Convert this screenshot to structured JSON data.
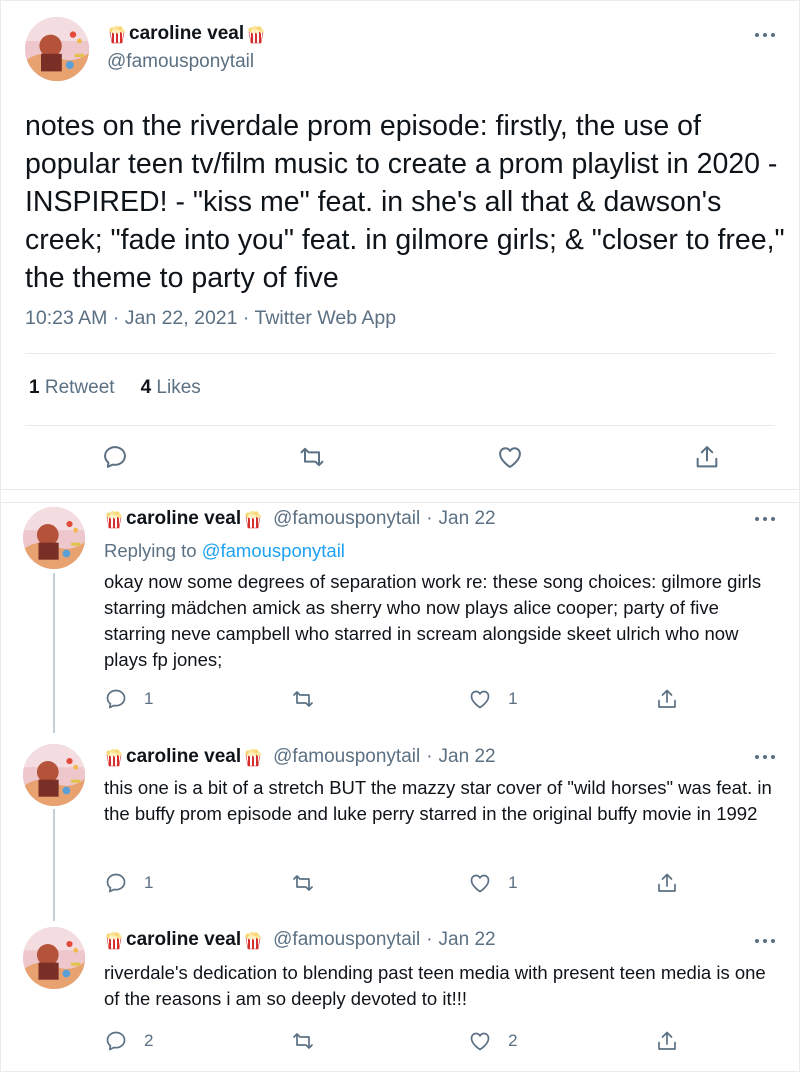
{
  "main_tweet": {
    "display_name": "caroline veal",
    "handle": "@famousponytail",
    "text": "notes on the riverdale prom episode: firstly, the use of popular teen tv/film music to create a prom playlist in 2020 - INSPIRED! - \"kiss me\" feat. in she's all that & dawson's creek; \"fade into you\" feat. in gilmore girls; & \"closer to free,\" the theme to party of five",
    "time": "10:23 AM",
    "date": "Jan 22, 2021",
    "source": "Twitter Web App",
    "retweets_count": "1",
    "retweets_label": "Retweet",
    "likes_count": "4",
    "likes_label": "Likes"
  },
  "replies": [
    {
      "display_name": "caroline veal",
      "handle": "@famousponytail",
      "date": "Jan 22",
      "replying_prefix": "Replying to",
      "replying_to": "@famousponytail",
      "text": "okay now some degrees of separation work re: these song choices: gilmore girls starring mädchen amick as sherry who now plays alice cooper; party of five starring neve campbell who starred in scream alongside skeet ulrich who now plays fp jones;",
      "reply_count": "1",
      "retweet_count": "",
      "like_count": "1"
    },
    {
      "display_name": "caroline veal",
      "handle": "@famousponytail",
      "date": "Jan 22",
      "text": "this one is a bit of a stretch BUT the mazzy star cover of \"wild horses\" was feat. in the buffy prom episode and luke perry starred in the original buffy movie in 1992",
      "reply_count": "1",
      "retweet_count": "",
      "like_count": "1"
    },
    {
      "display_name": "caroline veal",
      "handle": "@famousponytail",
      "date": "Jan 22",
      "text": "riverdale's dedication to blending past teen media with present teen media is one of the reasons i am so deeply devoted to it!!!",
      "reply_count": "2",
      "retweet_count": "",
      "like_count": "2"
    }
  ],
  "separator": "·",
  "icons": {
    "reply": "reply-icon",
    "retweet": "retweet-icon",
    "like": "heart-icon",
    "share": "share-icon",
    "more": "more-icon",
    "emoji": "popcorn-icon"
  },
  "colors": {
    "text": "#0f1419",
    "secondary": "#5b7083",
    "link": "#1da1f2",
    "border": "#e6ecf0"
  }
}
